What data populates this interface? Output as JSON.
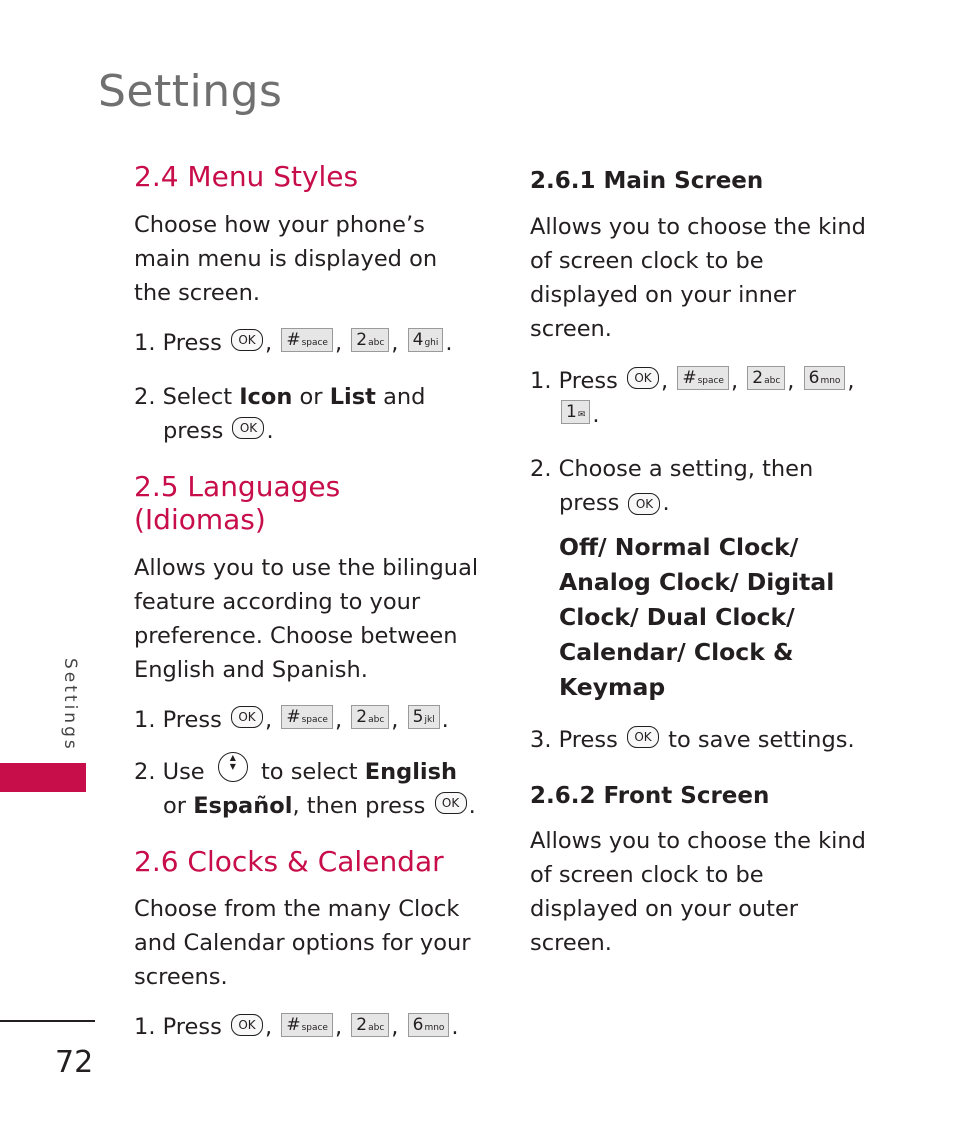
{
  "page": {
    "title": "Settings",
    "side_label": "Settings",
    "page_number": "72",
    "accent_color": "#c70d4a"
  },
  "left": {
    "menu_styles": {
      "heading": "2.4 Menu Styles",
      "intro": "Choose how your phone’s main menu is displayed on the screen.",
      "step1_prefix": "1. Press",
      "step1_keys": [
        {
          "main": "OK",
          "type": "ok"
        },
        {
          "main": "#",
          "sub": "space",
          "type": "key"
        },
        {
          "main": "2",
          "sub": "abc",
          "type": "key"
        },
        {
          "main": "4",
          "sub": "ghi",
          "type": "key"
        }
      ],
      "step2_prefix": "2. Select",
      "step2_opt1": "Icon",
      "step2_or": "or",
      "step2_opt2": "List",
      "step2_suffix": "and press",
      "ok": "OK"
    },
    "languages": {
      "heading": "2.5 Languages (Idiomas)",
      "intro": "Allows you to use the bilingual feature according to your preference. Choose between English and Spanish.",
      "step1_prefix": "1. Press",
      "step1_keys": [
        {
          "main": "OK"
        },
        {
          "main": "#",
          "sub": "space"
        },
        {
          "main": "2",
          "sub": "abc"
        },
        {
          "main": "5",
          "sub": "jkl"
        }
      ],
      "step2_prefix": "2. Use",
      "step2_mid": "to select",
      "step2_opt1": "English",
      "step2_or": "or",
      "step2_opt2": "Español",
      "step2_suffix": ", then press",
      "ok": "OK"
    },
    "clocks": {
      "heading": "2.6 Clocks & Calendar",
      "intro": "Choose from the many Clock and Calendar options for your screens.",
      "step1_prefix": "1. Press",
      "step1_keys": [
        {
          "main": "OK"
        },
        {
          "main": "#",
          "sub": "space"
        },
        {
          "main": "2",
          "sub": "abc"
        },
        {
          "main": "6",
          "sub": "mno"
        }
      ]
    }
  },
  "right": {
    "main_screen": {
      "heading": "2.6.1 Main Screen",
      "intro": "Allows you to choose the kind of screen clock to be displayed on your inner screen.",
      "step1_prefix": "1. Press",
      "step1_keys": [
        {
          "main": "OK"
        },
        {
          "main": "#",
          "sub": "space"
        },
        {
          "main": "2",
          "sub": "abc"
        },
        {
          "main": "6",
          "sub": "mno"
        },
        {
          "main": "1",
          "sub": "voicemail"
        }
      ],
      "step2": "2. Choose a setting, then press",
      "ok": "OK",
      "options": "Off/ Normal Clock/ Analog Clock/ Digital Clock/ Dual Clock/ Calendar/ Clock & Keymap",
      "step3_prefix": "3. Press",
      "step3_suffix": "to save settings."
    },
    "front_screen": {
      "heading": "2.6.2 Front Screen",
      "intro": "Allows you to choose the kind of screen clock to be displayed on your outer screen."
    }
  }
}
